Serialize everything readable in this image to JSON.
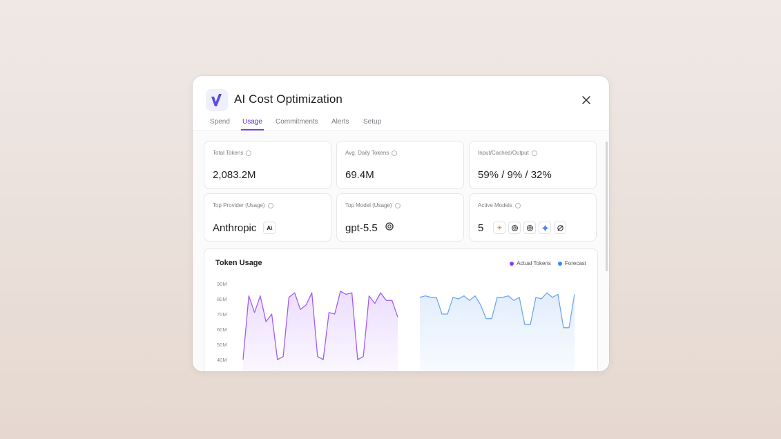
{
  "app": {
    "title": "AI Cost Optimization",
    "logo_icon": "vantage-v-logo",
    "close_icon": "close-icon",
    "accent_color": "#7b3fe4"
  },
  "tabs": [
    {
      "label": "Spend",
      "active": false
    },
    {
      "label": "Usage",
      "active": true
    },
    {
      "label": "Commitments",
      "active": false
    },
    {
      "label": "Alerts",
      "active": false
    },
    {
      "label": "Setup",
      "active": false
    }
  ],
  "metrics": [
    {
      "label": "Total Tokens",
      "value": "2,083.2M"
    },
    {
      "label": "Avg. Daily Tokens",
      "value": "69.4M"
    },
    {
      "label": "Input/Cached/Output",
      "value": "59% / 9% / 32%"
    },
    {
      "label": "Top Provider (Usage)",
      "value": "Anthropic",
      "icon": "anthropic-icon"
    },
    {
      "label": "Top Model (Usage)",
      "value": "gpt-5.5",
      "icon": "openai-icon"
    },
    {
      "label": "Active Models",
      "value": "5",
      "icons": [
        "claude-icon",
        "openai-icon",
        "openai-icon",
        "gemini-icon",
        "grok-icon"
      ]
    }
  ],
  "chart_data": {
    "type": "line",
    "title": "Token Usage",
    "ylabel": "",
    "yticks": [
      "90M",
      "80M",
      "70M",
      "60M",
      "50M",
      "40M"
    ],
    "ylim": [
      40,
      90
    ],
    "grid": false,
    "legend_position": "top-right",
    "series": [
      {
        "name": "Actual Tokens",
        "color": "#8b3cf0",
        "values": [
          40,
          82,
          71,
          82,
          65,
          70,
          40,
          42,
          81,
          84,
          73,
          76,
          84,
          42,
          40,
          71,
          70,
          85,
          83,
          84,
          40,
          42,
          82,
          77,
          84,
          79,
          79,
          68
        ]
      },
      {
        "name": "Forecast",
        "color": "#3b8bea",
        "values": [
          81,
          82,
          81,
          81,
          70,
          70,
          81,
          80,
          82,
          79,
          82,
          76,
          67,
          67,
          81,
          81,
          82,
          79,
          81,
          63,
          63,
          81,
          80,
          84,
          81,
          83,
          61,
          61,
          83
        ]
      }
    ]
  }
}
